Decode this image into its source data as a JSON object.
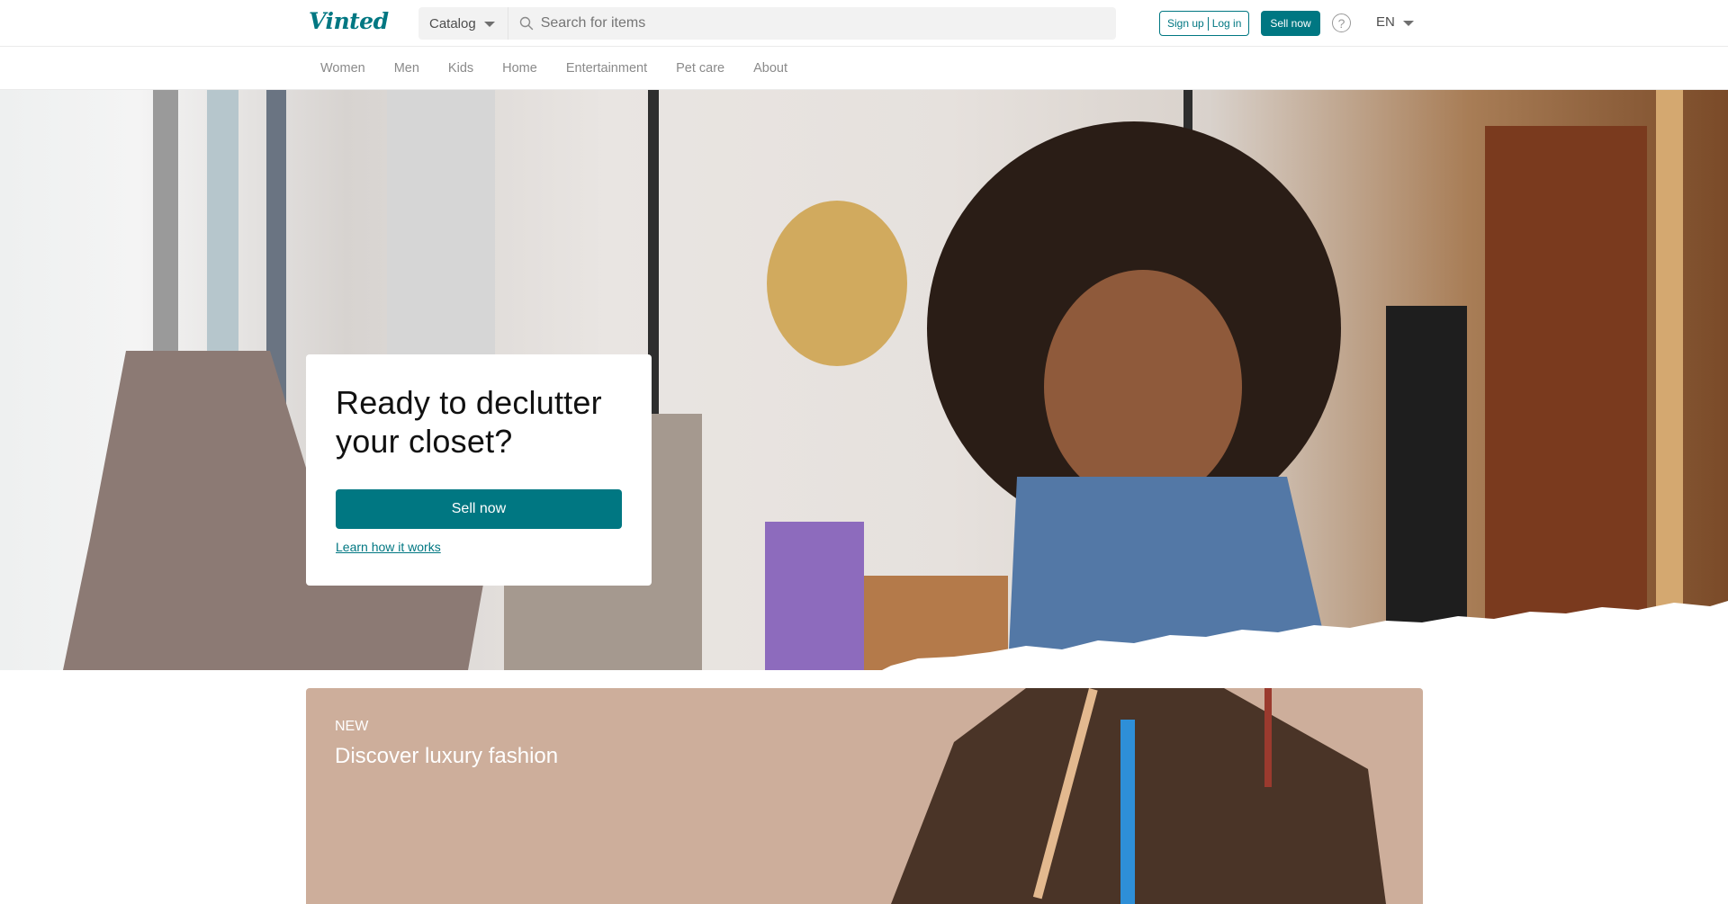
{
  "header": {
    "logo": "Vinted",
    "catalog_label": "Catalog",
    "search_placeholder": "Search for items",
    "sign_up_label": "Sign up",
    "log_in_label": "Log in",
    "sell_now_label": "Sell now",
    "help_icon": "question-circle-icon",
    "language": "EN"
  },
  "nav": {
    "items": [
      {
        "label": "Women"
      },
      {
        "label": "Men"
      },
      {
        "label": "Kids"
      },
      {
        "label": "Home"
      },
      {
        "label": "Entertainment"
      },
      {
        "label": "Pet care"
      },
      {
        "label": "About"
      }
    ]
  },
  "hero": {
    "title_line1": "Ready to declutter",
    "title_line2": "your closet?",
    "sell_button": "Sell now",
    "learn_link": "Learn how it works"
  },
  "luxury_banner": {
    "badge": "NEW",
    "title": "Discover luxury fashion"
  },
  "colors": {
    "brand": "#007782",
    "banner_bg": "#cdae9b"
  }
}
